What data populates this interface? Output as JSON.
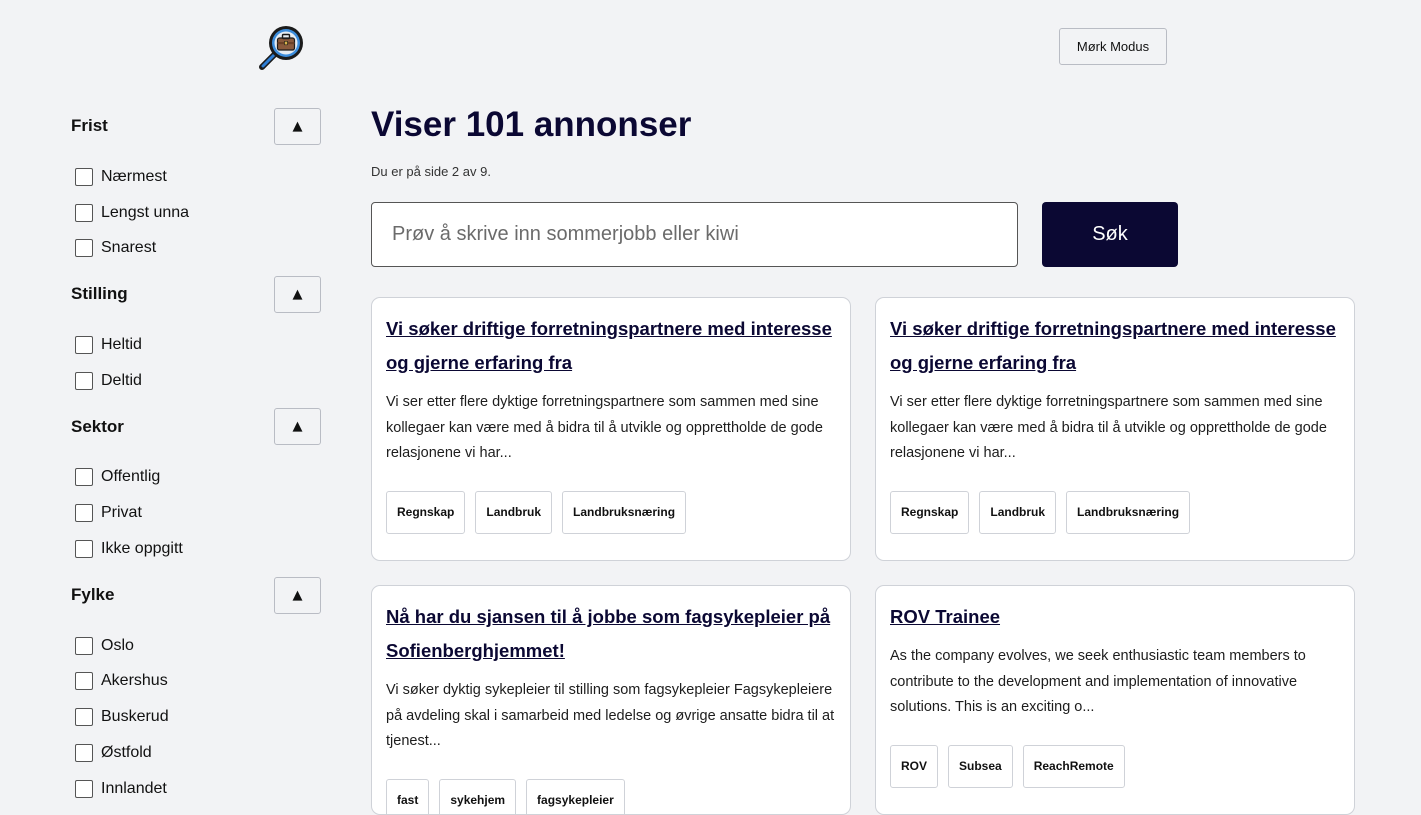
{
  "header": {
    "logo_icon": "briefcase-magnifier-icon",
    "mode_button": "Mørk Modus"
  },
  "filters": {
    "toggle_symbol": "▲",
    "sections": [
      {
        "title": "Frist",
        "options": [
          "Nærmest",
          "Lengst unna",
          "Snarest"
        ]
      },
      {
        "title": "Stilling",
        "options": [
          "Heltid",
          "Deltid"
        ]
      },
      {
        "title": "Sektor",
        "options": [
          "Offentlig",
          "Privat",
          "Ikke oppgitt"
        ]
      },
      {
        "title": "Fylke",
        "options": [
          "Oslo",
          "Akershus",
          "Buskerud",
          "Østfold",
          "Innlandet"
        ]
      }
    ]
  },
  "main": {
    "title": "Viser 101 annonser",
    "page_info": "Du er på side 2 av 9.",
    "search_placeholder": "Prøv å skrive inn sommerjobb eller kiwi",
    "search_button": "Søk"
  },
  "listings": [
    {
      "title": "Vi søker driftige forretningspartnere med interesse og gjerne erfaring fra",
      "description": "Vi ser etter flere dyktige forretningspartnere som sammen med sine kollegaer kan være med å bidra til å utvikle og opprettholde de gode relasjonene vi har...",
      "tags": [
        "Regnskap",
        "Landbruk",
        "Landbruksnæring"
      ]
    },
    {
      "title": "Vi søker driftige forretningspartnere med interesse og gjerne erfaring fra",
      "description": "Vi ser etter flere dyktige forretningspartnere som sammen med sine kollegaer kan være med å bidra til å utvikle og opprettholde de gode relasjonene vi har...",
      "tags": [
        "Regnskap",
        "Landbruk",
        "Landbruksnæring"
      ]
    },
    {
      "title": "Nå har du sjansen til å jobbe som fagsykepleier på Sofienberghjemmet!",
      "description": "Vi søker dyktig sykepleier til stilling som fagsykepleier Fagsykepleiere på avdeling skal i samarbeid med ledelse og øvrige ansatte bidra til at tjenest...",
      "tags": [
        "fast",
        "sykehjem",
        "fagsykepleier"
      ]
    },
    {
      "title": "ROV Trainee",
      "description": "As the company evolves, we seek enthusiastic team members to contribute to the development and implementation of innovative solutions. This is an exciting o...",
      "tags": [
        "ROV",
        "Subsea",
        "ReachRemote"
      ]
    }
  ]
}
